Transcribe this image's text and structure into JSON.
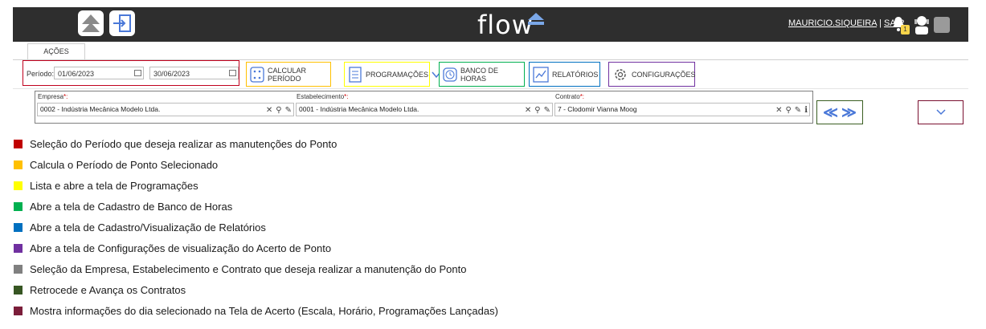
{
  "header": {
    "logo_text": "flow",
    "user_name": "MAURICIO.SIQUEIRA",
    "separator": "|",
    "logout_label": "SAIR",
    "notification_count": "1"
  },
  "tabs": [
    {
      "label": "AÇÕES"
    }
  ],
  "toolbar": {
    "period_label": "Período:",
    "date_start": "01/06/2023",
    "date_end": "30/06/2023",
    "calc_label": "CALCULAR PERÍODO",
    "programs_label": "PROGRAMAÇÕES",
    "hours_bank_label": "BANCO DE HORAS",
    "reports_label": "RELATÓRIOS",
    "config_label": "CONFIGURAÇÕES"
  },
  "selection": {
    "company_label": "Empresa",
    "company_value": "0002 - Indústria Mecânica Modelo Ltda.",
    "establishment_label": "Estabelecimento",
    "establishment_value": "0001 - Indústria Mecânica Modelo Ltda.",
    "contract_label": "Contrato",
    "contract_value": "7 - Clodomir Vianna Moog",
    "required_mark": "*:"
  },
  "nav": {
    "prev": "≪",
    "next": "≫"
  },
  "legend": [
    {
      "color": "#c00000",
      "text": "Seleção do Período que deseja realizar as manutenções do Ponto"
    },
    {
      "color": "#ffc000",
      "text": "Calcula o Período de Ponto Selecionado"
    },
    {
      "color": "#ffff00",
      "text": "Lista e abre a tela de Programações"
    },
    {
      "color": "#00b050",
      "text": "Abre a tela de Cadastro de Banco de Horas"
    },
    {
      "color": "#0070c0",
      "text": "Abre a tela de Cadastro/Visualização de Relatórios"
    },
    {
      "color": "#7030a0",
      "text": "Abre a tela de Configurações de visualização do Acerto de Ponto"
    },
    {
      "color": "#808080",
      "text": "Seleção da Empresa, Estabelecimento e Contrato que deseja realizar a manutenção do Ponto"
    },
    {
      "color": "#375623",
      "text": "Retrocede e Avança os Contratos"
    },
    {
      "color": "#7b1e3a",
      "text": "Mostra informações do dia selecionado na Tela de Acerto (Escala, Horário, Programações Lançadas)"
    }
  ],
  "colors": {
    "topbar": "#2e2e2e",
    "accent_blue": "#4a78d8",
    "period_border": "#c0001d",
    "calc_border": "#ffc000",
    "programs_border": "#ffff00",
    "hours_border": "#00b050",
    "reports_border": "#0070c0",
    "config_border": "#7030a0"
  }
}
